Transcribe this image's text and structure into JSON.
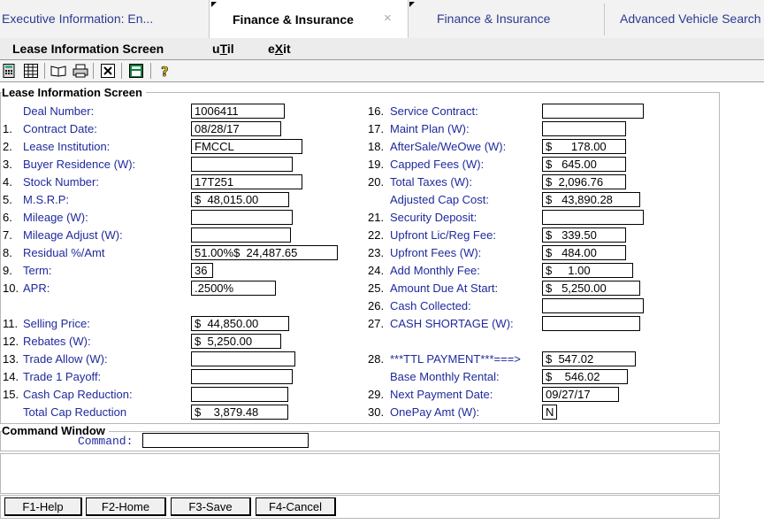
{
  "tabs": [
    {
      "label": "Executive  Information:  En..."
    },
    {
      "label": "Finance & Insurance",
      "close": "×"
    },
    {
      "label": "Finance & Insurance"
    },
    {
      "label": "Advanced Vehicle Search"
    }
  ],
  "menu": {
    "lease": "Lease Information Screen",
    "util_pre": "u",
    "util_u": "T",
    "util_post": "il",
    "exit_pre": "e",
    "exit_u": "X",
    "exit_post": "it"
  },
  "toolbar_icons": [
    "calculator-icon",
    "spreadsheet-icon",
    "open-book-icon",
    "printer-icon",
    "clear-x-icon",
    "calculator-green-icon",
    "help-icon"
  ],
  "section": {
    "title": "Lease Information Screen"
  },
  "left": [
    {
      "num": "",
      "label": "Deal Number:",
      "value": "1006411"
    },
    {
      "num": "1.",
      "label": "Contract Date:",
      "value": "08/28/17"
    },
    {
      "num": "2.",
      "label": "Lease Institution:",
      "value": "FMCCL"
    },
    {
      "num": "3.",
      "label": "Buyer Residence (W):",
      "value": ""
    },
    {
      "num": "4.",
      "label": "Stock Number:",
      "value": "17T251"
    },
    {
      "num": "5.",
      "label": "M.S.R.P:",
      "value": "$  48,015.00"
    },
    {
      "num": "6.",
      "label": "Mileage (W):",
      "value": ""
    },
    {
      "num": "7.",
      "label": "Mileage Adjust (W):",
      "value": ""
    },
    {
      "num": "8.",
      "label": "Residual %/Amt",
      "value": "51.00%$  24,487.65"
    },
    {
      "num": "9.",
      "label": "Term:",
      "value": "36"
    },
    {
      "num": "10.",
      "label": "APR:",
      "value": ".2500%"
    },
    {
      "num": "11.",
      "label": "Selling Price:",
      "value": "$  44,850.00"
    },
    {
      "num": "12.",
      "label": "Rebates (W):",
      "value": "$  5,250.00"
    },
    {
      "num": "13.",
      "label": "Trade Allow (W):",
      "value": ""
    },
    {
      "num": "14.",
      "label": "Trade 1 Payoff:",
      "value": ""
    },
    {
      "num": "15.",
      "label": "Cash Cap Reduction:",
      "value": ""
    },
    {
      "num": "",
      "label": "Total Cap Reduction",
      "value": "$    3,879.48"
    }
  ],
  "right": [
    {
      "num": "16.",
      "label": "Service Contract:",
      "value": ""
    },
    {
      "num": "17.",
      "label": "Maint Plan (W):",
      "value": ""
    },
    {
      "num": "18.",
      "label": "AfterSale/WeOwe (W):",
      "value": "$      178.00"
    },
    {
      "num": "19.",
      "label": "Capped Fees (W):",
      "value": "$   645.00"
    },
    {
      "num": "20.",
      "label": "Total Taxes (W):",
      "value": "$  2,096.76"
    },
    {
      "num": "",
      "label": "Adjusted Cap Cost:",
      "value": "$   43,890.28"
    },
    {
      "num": "21.",
      "label": "Security Deposit:",
      "value": ""
    },
    {
      "num": "22.",
      "label": "Upfront Lic/Reg Fee:",
      "value": "$   339.50"
    },
    {
      "num": "23.",
      "label": "Upfront Fees (W):",
      "value": "$   484.00"
    },
    {
      "num": "24.",
      "label": "Add Monthly Fee:",
      "value": "$     1.00"
    },
    {
      "num": "25.",
      "label": "Amount Due At Start:",
      "value": "$   5,250.00"
    },
    {
      "num": "26.",
      "label": "Cash Collected:",
      "value": ""
    },
    {
      "num": "27.",
      "label": "CASH SHORTAGE  (W):",
      "value": ""
    },
    {
      "num": "28.",
      "label": "***TTL PAYMENT***===>",
      "value": "$  547.02"
    },
    {
      "num": "",
      "label": "Base Monthly Rental:",
      "value": "$    546.02"
    },
    {
      "num": "29.",
      "label": "Next Payment Date:",
      "value": "09/27/17"
    },
    {
      "num": "30.",
      "label": "OnePay Amt (W):",
      "value": "N"
    }
  ],
  "command": {
    "title": "Command Window",
    "label": "Command:",
    "value": ""
  },
  "fkeys": [
    {
      "label": "F1-Help"
    },
    {
      "label": "F2-Home"
    },
    {
      "label": "F3-Save"
    },
    {
      "label": "F4-Cancel"
    }
  ]
}
